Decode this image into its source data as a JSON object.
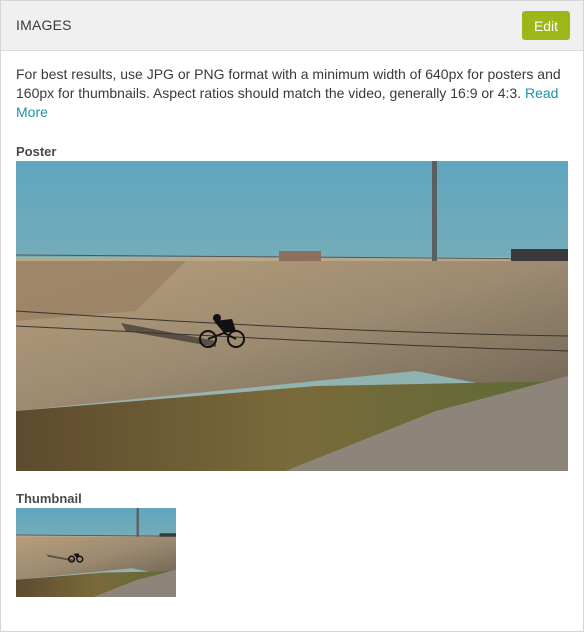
{
  "panel": {
    "title": "IMAGES",
    "edit_label": "Edit"
  },
  "description": {
    "text": "For best results, use JPG or PNG format with a minimum width of 640px for posters and 160px for thumbnails. Aspect ratios should match the video, generally 16:9 or 4:3.",
    "read_more": "Read More"
  },
  "poster": {
    "label": "Poster",
    "image": "velodrome-cyclist-photo"
  },
  "thumbnail": {
    "label": "Thumbnail",
    "image": "velodrome-cyclist-photo"
  },
  "colors": {
    "accent": "#9db71b",
    "link": "#1a93a8",
    "header_bg": "#f0f0f0"
  }
}
